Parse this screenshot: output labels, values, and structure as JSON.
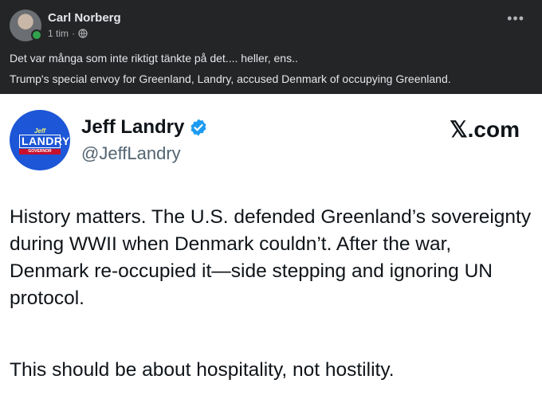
{
  "post": {
    "author": "Carl Norberg",
    "time": "1 tim",
    "privacy_icon": "globe-icon",
    "more_icon": "more-options-icon",
    "text_line1": "Det var många som inte riktigt tänkte på det.... heller, ens..",
    "text_line2": "Trump's special envoy for Greenland, Landry, accused Denmark of occupying Greenland."
  },
  "tweet": {
    "logo": {
      "text_top": "Jeff",
      "text_main": "LANDRY",
      "text_bottom": "GOVERNOR"
    },
    "name": "Jeff Landry",
    "handle": "@JeffLandry",
    "verified_icon": "verified-badge-icon",
    "source": "𝕏.com",
    "paragraph1": "History matters. The U.S. defended Greenland’s sovereignty during WWII when Denmark couldn’t. After the war, Denmark re-occupied it—side stepping and ignoring UN protocol.",
    "paragraph2": "This should be about hospitality, not hostility."
  },
  "colors": {
    "background_dark": "#242526",
    "text_light": "#e4e6eb",
    "muted": "#b0b3b8",
    "online": "#31a24c",
    "logo_blue": "#1d56d6",
    "verified_blue": "#1d9bf0"
  }
}
